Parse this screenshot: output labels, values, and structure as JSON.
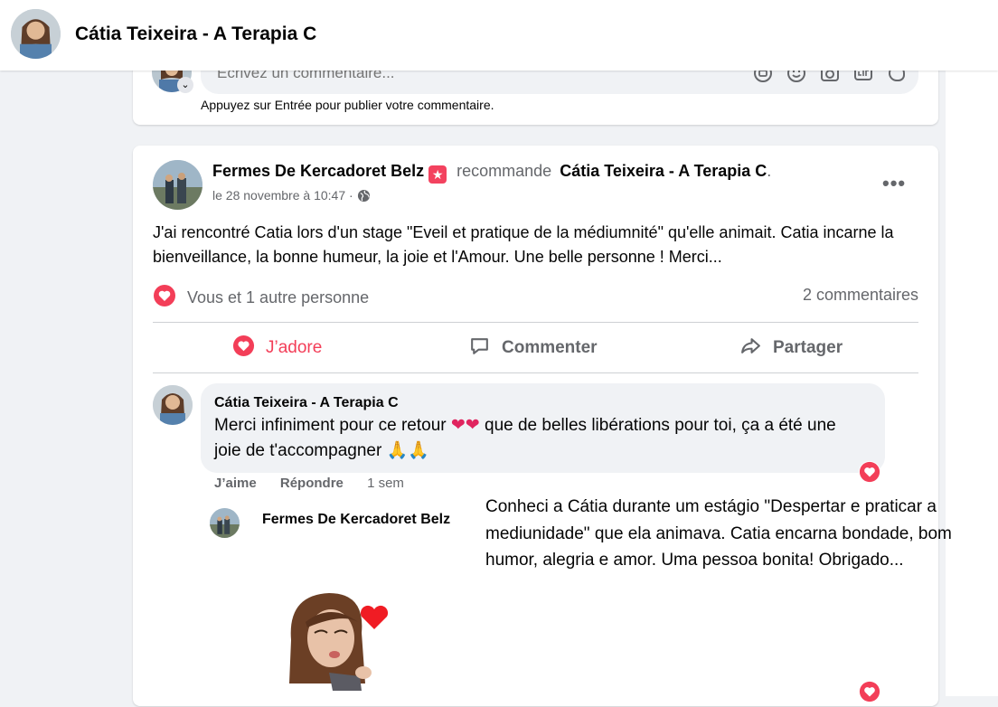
{
  "header": {
    "page_name": "Cátia Teixeira - A Terapia C"
  },
  "previous_post": {
    "comment_placeholder": "Écrivez un commentaire...",
    "hint": "Appuyez sur Entrée pour publier votre commentaire.",
    "input_icons": [
      "avatar-sticker-icon",
      "emoji-icon",
      "camera-icon",
      "gif-icon",
      "sticker-icon"
    ]
  },
  "post": {
    "author": "Fermes De Kercadoret Belz",
    "verb": "recommande",
    "target": "Cátia Teixeira - A Terapia C",
    "target_suffix": ".",
    "date": "le 28 novembre à 10:47 ·",
    "text": "J'ai rencontré Catia lors d'un stage \"Eveil et pratique de la médiumnité\" qu'elle animait. Catia incarne la bienveillance, la bonne humeur, la joie et l'Amour. Une belle personne ! Merci...",
    "more": "•••",
    "reactions_text": "Vous et 1 autre personne",
    "comments_count": "2 commentaires",
    "actions": {
      "love": "J’adore",
      "comment": "Commenter",
      "share": "Partager"
    }
  },
  "comment": {
    "author": "Cátia Teixeira - A Terapia C",
    "text_part1": "Merci infiniment pour ce retour",
    "hearts": "❤️❤️",
    "text_part2": " que de belles libérations pour toi, ça a été une joie de t'accompagner",
    "hands": "🙏🙏",
    "like": "J’aime",
    "reply": "Répondre",
    "time": "1 sem"
  },
  "reply": {
    "author": "Fermes De Kercadoret Belz"
  },
  "translation": {
    "text": "Conheci a Cátia durante um estágio \"Despertar e praticar a mediunidade\" que ela animava. Catia encarna bondade, bom humor, alegria e amor. Uma pessoa bonita! Obrigado..."
  },
  "colors": {
    "love_red": "#f33e58",
    "muted": "#65676b",
    "bubble": "#f0f2f5",
    "divider": "#ced0d4"
  }
}
